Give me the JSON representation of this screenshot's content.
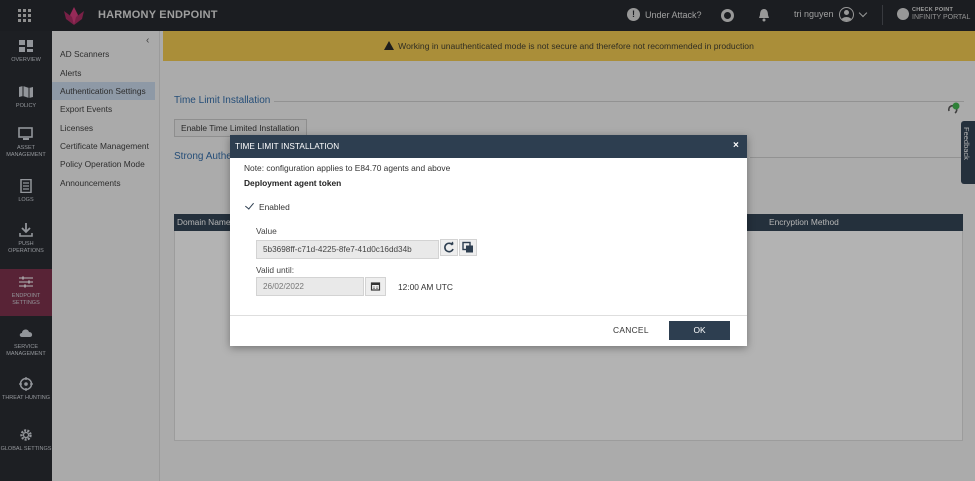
{
  "app": {
    "product_name": "HARMONY ENDPOINT",
    "under_attack_label": "Under Attack?",
    "user_name": "tri nguyen",
    "brand_line1": "CHECK POINT",
    "brand_line2": "INFINITY PORTAL"
  },
  "nav": {
    "items": [
      {
        "label": "OVERVIEW",
        "icon": "dashboard-grid-icon"
      },
      {
        "label": "POLICY",
        "icon": "map-icon"
      },
      {
        "label": "ASSET MANAGEMENT",
        "icon": "computer-icon"
      },
      {
        "label": "LOGS",
        "icon": "document-icon"
      },
      {
        "label": "PUSH OPERATIONS",
        "icon": "download-icon"
      },
      {
        "label": "ENDPOINT SETTINGS",
        "icon": "sliders-icon"
      },
      {
        "label": "SERVICE MANAGEMENT",
        "icon": "cloud-icon"
      },
      {
        "label": "THREAT HUNTING",
        "icon": "crosshair-icon"
      },
      {
        "label": "GLOBAL SETTINGS",
        "icon": "gear-icon"
      }
    ],
    "active": "ENDPOINT SETTINGS"
  },
  "submenu": {
    "collapse_glyph": "‹",
    "items": [
      {
        "label": "AD Scanners"
      },
      {
        "label": "Alerts"
      },
      {
        "label": "Authentication Settings"
      },
      {
        "label": "Export Events"
      },
      {
        "label": "Licenses"
      },
      {
        "label": "Certificate Management"
      },
      {
        "label": "Policy Operation Mode"
      },
      {
        "label": "Announcements"
      }
    ],
    "active": "Authentication Settings"
  },
  "main": {
    "warning_text": "Working in unauthenticated mode is not secure and therefore not recommended in production",
    "section_time_limit": "Time Limit Installation",
    "enable_button_label": "Enable Time Limited Installation",
    "section_strong_auth": "Strong Authe",
    "table_headers": [
      "Domain Name",
      "Encryption Method"
    ],
    "feedback_label": "Feedback"
  },
  "modal": {
    "title": "TIME LIMIT INSTALLATION",
    "close_glyph": "×",
    "note": "Note: configuration applies to E84.70 agents and above",
    "token_title": "Deployment agent token",
    "enabled_label": "Enabled",
    "enabled_checked": true,
    "value_label": "Value",
    "token_value": "5b3698ff-c71d-4225-8fe7-41d0c16dd34b",
    "valid_until_label": "Valid until:",
    "valid_until_date": "26/02/2022",
    "time_label": "12:00 AM UTC",
    "cancel_label": "CANCEL",
    "ok_label": "OK"
  },
  "colors": {
    "header_navy": "#2d3e50",
    "warning_yellow": "#f2c94c",
    "active_nav": "#7a2b47",
    "accent_blue": "#2f6aa8"
  }
}
